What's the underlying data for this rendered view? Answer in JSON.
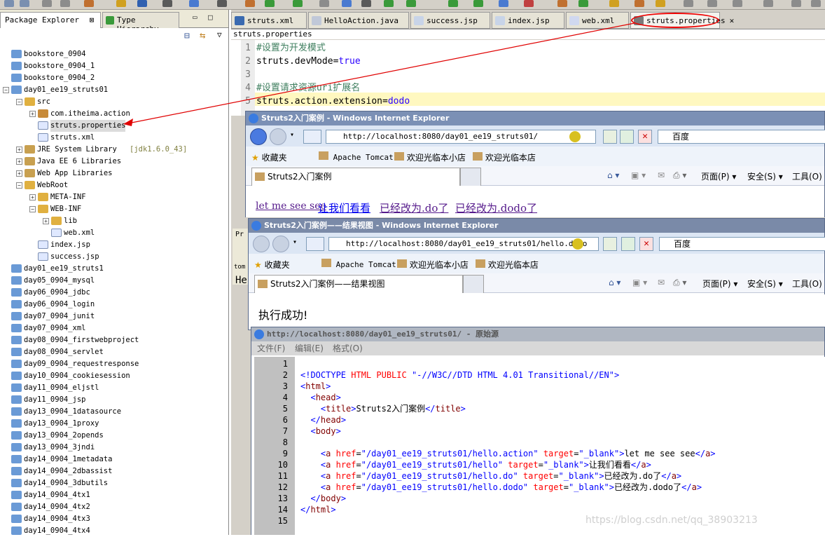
{
  "toolbar": {
    "label": "Toolbar"
  },
  "left_panel": {
    "tabs": [
      {
        "label": "Package Explorer"
      },
      {
        "label": "Type Hierarchy"
      }
    ],
    "close_glyph": "⊠",
    "ctl_min": "▭",
    "ctl_max": "□",
    "collapse": "⊟",
    "link": "⇆",
    "menu": "▽",
    "tree": [
      {
        "label": "bookstore_0904",
        "indent": 0,
        "icon": "project-icon",
        "expand": ""
      },
      {
        "label": "bookstore_0904_1",
        "indent": 0,
        "icon": "project-icon",
        "expand": ""
      },
      {
        "label": "bookstore_0904_2",
        "indent": 0,
        "icon": "project-icon",
        "expand": ""
      },
      {
        "label": "day01_ee19_struts01",
        "indent": 0,
        "icon": "project-icon",
        "expand": "−"
      },
      {
        "label": "src",
        "indent": 1,
        "icon": "source-folder-icon",
        "expand": "−"
      },
      {
        "label": "com.itheima.action",
        "indent": 2,
        "icon": "package-icon",
        "expand": "+"
      },
      {
        "label": "struts.properties",
        "indent": 2,
        "icon": "properties-file-icon",
        "expand": "",
        "selected": true
      },
      {
        "label": "struts.xml",
        "indent": 2,
        "icon": "gear-icon",
        "expand": ""
      },
      {
        "label": "JRE System Library",
        "extra": "[jdk1.6.0_43]",
        "indent": 1,
        "icon": "library-icon",
        "expand": "+"
      },
      {
        "label": "Java EE 6 Libraries",
        "indent": 1,
        "icon": "library-icon",
        "expand": "+"
      },
      {
        "label": "Web App Libraries",
        "indent": 1,
        "icon": "library-icon",
        "expand": "+"
      },
      {
        "label": "WebRoot",
        "indent": 1,
        "icon": "folder-icon",
        "expand": "−"
      },
      {
        "label": "META-INF",
        "indent": 2,
        "icon": "folder-icon",
        "expand": "+"
      },
      {
        "label": "WEB-INF",
        "indent": 2,
        "icon": "folder-icon",
        "expand": "−"
      },
      {
        "label": "lib",
        "indent": 3,
        "icon": "folder-icon",
        "expand": "+"
      },
      {
        "label": "web.xml",
        "indent": 3,
        "icon": "xml-file-icon",
        "expand": ""
      },
      {
        "label": "index.jsp",
        "indent": 2,
        "icon": "jsp-file-icon",
        "expand": ""
      },
      {
        "label": "success.jsp",
        "indent": 2,
        "icon": "jsp-file-icon",
        "expand": ""
      },
      {
        "label": "day01_ee19_struts1",
        "indent": 0,
        "icon": "project-icon",
        "expand": ""
      },
      {
        "label": "day05_0904_mysql",
        "indent": 0,
        "icon": "project-icon",
        "expand": ""
      },
      {
        "label": "day06_0904_jdbc",
        "indent": 0,
        "icon": "project-icon",
        "expand": ""
      },
      {
        "label": "day06_0904_login",
        "indent": 0,
        "icon": "project-icon",
        "expand": ""
      },
      {
        "label": "day07_0904_junit",
        "indent": 0,
        "icon": "project-icon",
        "expand": ""
      },
      {
        "label": "day07_0904_xml",
        "indent": 0,
        "icon": "project-icon",
        "expand": ""
      },
      {
        "label": "day08_0904_firstwebproject",
        "indent": 0,
        "icon": "project-icon",
        "expand": ""
      },
      {
        "label": "day08_0904_servlet",
        "indent": 0,
        "icon": "project-icon",
        "expand": ""
      },
      {
        "label": "day09_0904_requestresponse",
        "indent": 0,
        "icon": "project-icon",
        "expand": ""
      },
      {
        "label": "day10_0904_cookiesession",
        "indent": 0,
        "icon": "project-icon",
        "expand": ""
      },
      {
        "label": "day11_0904_eljstl",
        "indent": 0,
        "icon": "project-icon",
        "expand": ""
      },
      {
        "label": "day11_0904_jsp",
        "indent": 0,
        "icon": "project-icon",
        "expand": ""
      },
      {
        "label": "day13_0904_1datasource",
        "indent": 0,
        "icon": "project-icon",
        "expand": ""
      },
      {
        "label": "day13_0904_1proxy",
        "indent": 0,
        "icon": "project-icon",
        "expand": ""
      },
      {
        "label": "day13_0904_2opends",
        "indent": 0,
        "icon": "project-icon",
        "expand": ""
      },
      {
        "label": "day13_0904_3jndi",
        "indent": 0,
        "icon": "project-icon",
        "expand": ""
      },
      {
        "label": "day14_0904_1metadata",
        "indent": 0,
        "icon": "project-icon",
        "expand": ""
      },
      {
        "label": "day14_0904_2dbassist",
        "indent": 0,
        "icon": "project-icon",
        "expand": ""
      },
      {
        "label": "day14_0904_3dbutils",
        "indent": 0,
        "icon": "project-icon",
        "expand": ""
      },
      {
        "label": "day14_0904_4tx1",
        "indent": 0,
        "icon": "project-icon",
        "expand": ""
      },
      {
        "label": "day14_0904_4tx2",
        "indent": 0,
        "icon": "project-icon",
        "expand": ""
      },
      {
        "label": "day14_0904_4tx3",
        "indent": 0,
        "icon": "project-icon",
        "expand": ""
      },
      {
        "label": "day14_0904_4tx4",
        "indent": 0,
        "icon": "project-icon",
        "expand": ""
      }
    ]
  },
  "editor": {
    "tabs": [
      {
        "label": "struts.xml",
        "icon": "gear-icon"
      },
      {
        "label": "HelloAction.java",
        "icon": "java-file-icon"
      },
      {
        "label": "success.jsp",
        "icon": "jsp-file-icon"
      },
      {
        "label": "index.jsp",
        "icon": "jsp-file-icon"
      },
      {
        "label": "web.xml",
        "icon": "xml-file-icon"
      },
      {
        "label": "struts.properties",
        "icon": "properties-file-icon",
        "active": true,
        "close": "✕"
      }
    ],
    "breadcrumb": "struts.properties",
    "lines": [
      {
        "n": "1",
        "comment": "#设置为开发模式",
        "key": "",
        "val": ""
      },
      {
        "n": "2",
        "comment": "",
        "key": "struts.devMode=",
        "val": "true"
      },
      {
        "n": "3",
        "comment": "",
        "key": "",
        "val": ""
      },
      {
        "n": "4",
        "comment": "#设置请求资源uri扩展名",
        "key": "",
        "val": ""
      },
      {
        "n": "5",
        "comment": "",
        "key": "struts.action.extension=",
        "val": "dodo"
      }
    ]
  },
  "ie1": {
    "title": "Struts2入门案例 - Windows Internet Explorer",
    "url": "http://localhost:8080/day01_ee19_struts01/",
    "search": "百度",
    "favorites": "收藏夹",
    "fav_links": [
      "Apache Tomcat",
      "欢迎光临本小店",
      "欢迎光临本店"
    ],
    "tab": "Struts2入门案例",
    "cmd": {
      "page": "页面(P)",
      "safety": "安全(S)",
      "tools": "工具(O)"
    },
    "links": [
      "let me see see",
      "让我们看看",
      "已经改为.do了",
      "已经改为.dodo了"
    ]
  },
  "ie2": {
    "title": "Struts2入门案例——结果视图 - Windows Internet Explorer",
    "url": "http://localhost:8080/day01_ee19_struts01/hello.dodo",
    "search": "百度",
    "favorites": "收藏夹",
    "fav_links": [
      "Apache Tomcat",
      "欢迎光临本小店",
      "欢迎光临本店"
    ],
    "tab": "Struts2入门案例——结果视图",
    "cmd": {
      "page": "页面(P)",
      "safety": "安全(S)",
      "tools": "工具(O)"
    },
    "body": "执行成功!"
  },
  "source": {
    "title": "http://localhost:8080/day01_ee19_struts01/ - 原始源",
    "menu": [
      "文件(F)",
      "编辑(E)",
      "格式(O)"
    ],
    "lines": [
      {
        "n": "1",
        "parts": []
      },
      {
        "n": "2",
        "parts": [
          {
            "c": "vl",
            "t": "<!DOCTYPE "
          },
          {
            "c": "at",
            "t": "HTML PUBLIC "
          },
          {
            "c": "vl",
            "t": "\"-//W3C//DTD HTML 4.01 Transitional//EN\">"
          }
        ]
      },
      {
        "n": "3",
        "parts": [
          {
            "c": "vl",
            "t": "<"
          },
          {
            "c": "tg",
            "t": "html"
          },
          {
            "c": "vl",
            "t": ">"
          }
        ]
      },
      {
        "n": "4",
        "parts": [
          {
            "c": "tx",
            "t": "  "
          },
          {
            "c": "vl",
            "t": "<"
          },
          {
            "c": "tg",
            "t": "head"
          },
          {
            "c": "vl",
            "t": ">"
          }
        ]
      },
      {
        "n": "5",
        "parts": [
          {
            "c": "tx",
            "t": "    "
          },
          {
            "c": "vl",
            "t": "<"
          },
          {
            "c": "tg",
            "t": "title"
          },
          {
            "c": "vl",
            "t": ">"
          },
          {
            "c": "tx",
            "t": "Struts2入门案例"
          },
          {
            "c": "vl",
            "t": "</"
          },
          {
            "c": "tg",
            "t": "title"
          },
          {
            "c": "vl",
            "t": ">"
          }
        ]
      },
      {
        "n": "6",
        "parts": [
          {
            "c": "tx",
            "t": "  "
          },
          {
            "c": "vl",
            "t": "</"
          },
          {
            "c": "tg",
            "t": "head"
          },
          {
            "c": "vl",
            "t": ">"
          }
        ]
      },
      {
        "n": "7",
        "parts": [
          {
            "c": "tx",
            "t": "  "
          },
          {
            "c": "vl",
            "t": "<"
          },
          {
            "c": "tg",
            "t": "body"
          },
          {
            "c": "vl",
            "t": ">"
          }
        ]
      },
      {
        "n": "8",
        "parts": []
      },
      {
        "n": "9",
        "parts": [
          {
            "c": "tx",
            "t": "    "
          },
          {
            "c": "vl",
            "t": "<"
          },
          {
            "c": "tg",
            "t": "a "
          },
          {
            "c": "at",
            "t": "href"
          },
          {
            "c": "tx",
            "t": "="
          },
          {
            "c": "vl",
            "t": "\"/day01_ee19_struts01/hello.action\" "
          },
          {
            "c": "at",
            "t": "target"
          },
          {
            "c": "tx",
            "t": "="
          },
          {
            "c": "vl",
            "t": "\"_blank\">"
          },
          {
            "c": "tx",
            "t": "let me see see"
          },
          {
            "c": "vl",
            "t": "</"
          },
          {
            "c": "tg",
            "t": "a"
          },
          {
            "c": "vl",
            "t": ">"
          }
        ]
      },
      {
        "n": "10",
        "parts": [
          {
            "c": "tx",
            "t": "    "
          },
          {
            "c": "vl",
            "t": "<"
          },
          {
            "c": "tg",
            "t": "a "
          },
          {
            "c": "at",
            "t": "href"
          },
          {
            "c": "tx",
            "t": "="
          },
          {
            "c": "vl",
            "t": "\"/day01_ee19_struts01/hello\" "
          },
          {
            "c": "at",
            "t": "target"
          },
          {
            "c": "tx",
            "t": "="
          },
          {
            "c": "vl",
            "t": "\"_blank\">"
          },
          {
            "c": "tx",
            "t": "让我们看看"
          },
          {
            "c": "vl",
            "t": "</"
          },
          {
            "c": "tg",
            "t": "a"
          },
          {
            "c": "vl",
            "t": ">"
          }
        ]
      },
      {
        "n": "11",
        "parts": [
          {
            "c": "tx",
            "t": "    "
          },
          {
            "c": "vl",
            "t": "<"
          },
          {
            "c": "tg",
            "t": "a "
          },
          {
            "c": "at",
            "t": "href"
          },
          {
            "c": "tx",
            "t": "="
          },
          {
            "c": "vl",
            "t": "\"/day01_ee19_struts01/hello.do\" "
          },
          {
            "c": "at",
            "t": "target"
          },
          {
            "c": "tx",
            "t": "="
          },
          {
            "c": "vl",
            "t": "\"_blank\">"
          },
          {
            "c": "tx",
            "t": "已经改为.do了"
          },
          {
            "c": "vl",
            "t": "</"
          },
          {
            "c": "tg",
            "t": "a"
          },
          {
            "c": "vl",
            "t": ">"
          }
        ]
      },
      {
        "n": "12",
        "parts": [
          {
            "c": "tx",
            "t": "    "
          },
          {
            "c": "vl",
            "t": "<"
          },
          {
            "c": "tg",
            "t": "a "
          },
          {
            "c": "at",
            "t": "href"
          },
          {
            "c": "tx",
            "t": "="
          },
          {
            "c": "vl",
            "t": "\"/day01_ee19_struts01/hello.dodo\" "
          },
          {
            "c": "at",
            "t": "target"
          },
          {
            "c": "tx",
            "t": "="
          },
          {
            "c": "vl",
            "t": "\"_blank\">"
          },
          {
            "c": "tx",
            "t": "已经改为.dodo了"
          },
          {
            "c": "vl",
            "t": "</"
          },
          {
            "c": "tg",
            "t": "a"
          },
          {
            "c": "vl",
            "t": ">"
          }
        ]
      },
      {
        "n": "13",
        "parts": [
          {
            "c": "tx",
            "t": "  "
          },
          {
            "c": "vl",
            "t": "</"
          },
          {
            "c": "tg",
            "t": "body"
          },
          {
            "c": "vl",
            "t": ">"
          }
        ]
      },
      {
        "n": "14",
        "parts": [
          {
            "c": "vl",
            "t": "</"
          },
          {
            "c": "tg",
            "t": "html"
          },
          {
            "c": "vl",
            "t": ">"
          }
        ]
      },
      {
        "n": "15",
        "parts": []
      }
    ]
  },
  "side": {
    "pr": "Pr",
    "tom": "tom",
    "he": "He"
  },
  "watermark": "https://blog.csdn.net/qq_38903213",
  "colors": {
    "annotation": "#e00000"
  }
}
